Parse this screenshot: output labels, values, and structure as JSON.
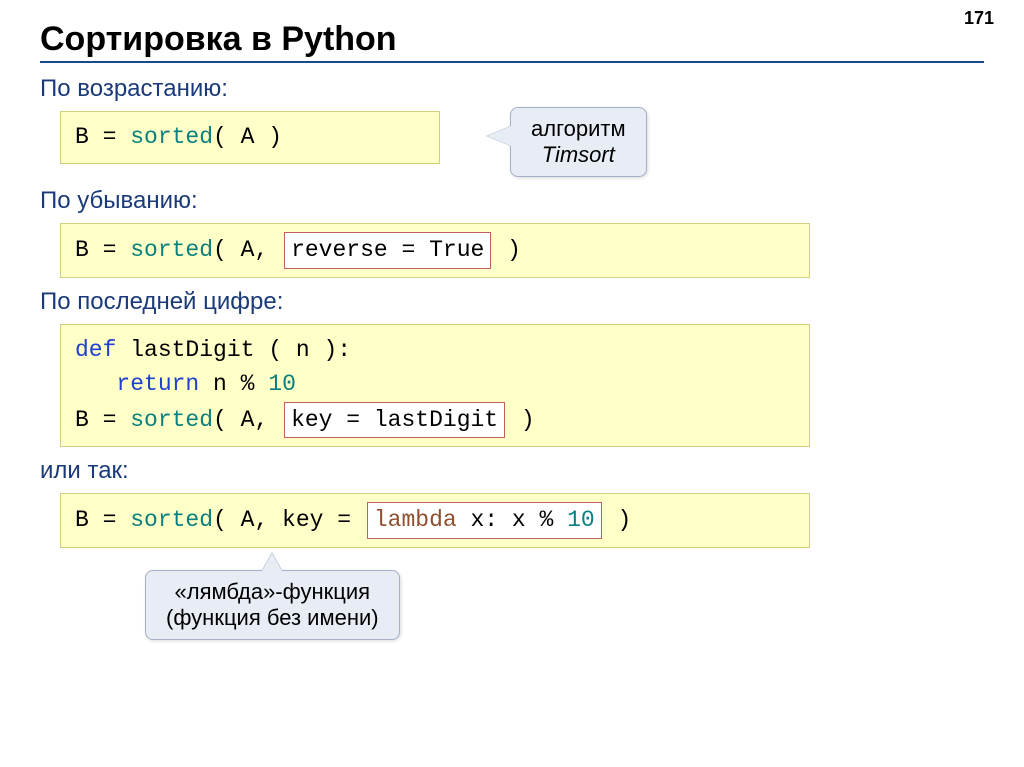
{
  "page_number": "171",
  "title": "Сортировка в Python",
  "sections": {
    "asc": {
      "label": "По возрастанию:"
    },
    "desc": {
      "label": "По убыванию:"
    },
    "last_digit": {
      "label": "По последней цифре:"
    },
    "or_so": {
      "label": "или так:"
    }
  },
  "code": {
    "asc": {
      "b_eq": "B = ",
      "sorted": "sorted",
      "open": "( A )"
    },
    "desc": {
      "b_eq": "B = ",
      "sorted": "sorted",
      "open": "( A, ",
      "hl": "reverse = True",
      "close": " )"
    },
    "lastdigit_def": {
      "def": "def",
      "fname": " lastDigit ( n ):",
      "ret": "return",
      "expr_n": " n % ",
      "ten": "10",
      "b_eq": "B = ",
      "sorted": "sorted",
      "open": "( A, ",
      "hl": "key = lastDigit",
      "close": " )"
    },
    "lambda": {
      "b_eq": "B = ",
      "sorted": "sorted",
      "open": "( A, key = ",
      "hl_lambda": "lambda",
      "hl_rest": " x: x % ",
      "hl_ten": "10",
      "close": "  )"
    }
  },
  "callouts": {
    "timsort": {
      "line1": "алгоритм",
      "line2": "Timsort"
    },
    "lambda": {
      "line1": "«лямбда»-функция",
      "line2": "(функция без имени)"
    }
  }
}
